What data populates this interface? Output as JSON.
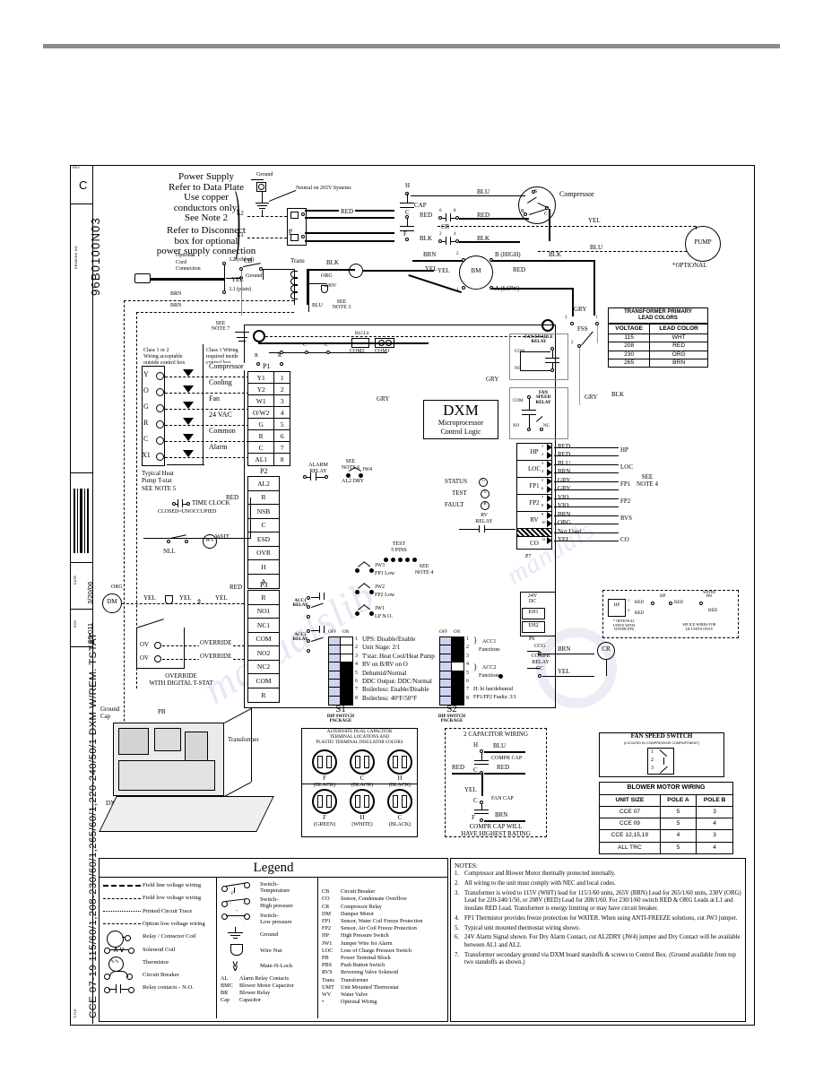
{
  "titleblock": {
    "rev_label": "REV.",
    "rev": "C",
    "drawing_no_label": "DRAWING NO.",
    "drawing_no": "96B0100N03",
    "date_label": "DATE:",
    "date": "3/20/06",
    "ecr_label": "ECR",
    "ecr": "06-011",
    "title_label": "TITLE:",
    "title": "CCE 07-19 115/60/1,208-230/60/1,265/60/1,220-240/50/1 DXM W/REM. TSTAT"
  },
  "power_supply": {
    "heading": [
      "Power Supply",
      "Refer to Data Plate",
      "Use copper",
      "conductors only.",
      "See Note 2"
    ],
    "disconnect": [
      "Refer to Disconnect",
      "box for optional",
      "power supply connection"
    ],
    "ground": "Ground",
    "neutral": "Neutral on 265V Systems",
    "l1": "L1",
    "l2": "L2",
    "pb": "PB",
    "optional_cord": [
      "Optional",
      "Cord",
      "Connection"
    ],
    "l2_ribbed": "L2 (ribbed)",
    "l1_plain": "L1 (plain)",
    "ground_lead": "Ground"
  },
  "wire_colors": {
    "brn": "BRN",
    "blu": "BLU",
    "red": "RED",
    "blk": "BLK",
    "yel": "YEL",
    "gry": "GRY",
    "org": "ORG",
    "vio": "VIO",
    "wht": "WHT",
    "ccg": "CCG",
    "cc": "CC"
  },
  "transformer": {
    "cb": "CB",
    "trans": "Trans",
    "org": "ORG",
    "volts": "230V",
    "see_note3": [
      "SEE",
      "NOTE 3"
    ],
    "yel": "YEL",
    "blu": "BLU",
    "blk": "BLK"
  },
  "compressor_section": {
    "h": "H",
    "c": "C",
    "f": "F",
    "cap": "CAP",
    "cr": "CR",
    "cr_terminals": [
      "6",
      "8",
      "2",
      "4"
    ],
    "compressor": "Compressor",
    "comp_terms": [
      "S",
      "R",
      "C"
    ],
    "bm": "BM",
    "b_high": "B (HIGH)",
    "a_low": "A (LOW)",
    "bm_terms": [
      "2",
      "1"
    ],
    "pump": "PUMP",
    "pump_note": "*OPTIONAL"
  },
  "thermostat": {
    "class_outside": [
      "Class 1 or 2",
      "Wiring acceptable",
      "outside control box"
    ],
    "class_inside": [
      "Class 1 Wiring",
      "required inside",
      "control box"
    ],
    "see_note7": [
      "SEE",
      "NOTE 7"
    ],
    "terminals": [
      "Y",
      "O",
      "G",
      "R",
      "C",
      "X1"
    ],
    "functions": [
      "Compressor",
      "Cooling",
      "Fan",
      "24 VAC",
      "Common",
      "Alarm"
    ],
    "caption": [
      "Typical Heat",
      "Pump T-stat",
      "SEE NOTE 5"
    ]
  },
  "p1": {
    "label": "P1",
    "rows": [
      {
        "name": "Y1",
        "pin": "1"
      },
      {
        "name": "Y2",
        "pin": "2"
      },
      {
        "name": "W1",
        "pin": "3"
      },
      {
        "name": "O/W2",
        "pin": "4"
      },
      {
        "name": "G",
        "pin": "5"
      },
      {
        "name": "R",
        "pin": "6"
      },
      {
        "name": "C",
        "pin": "7"
      },
      {
        "name": "AL1",
        "pin": "8"
      }
    ]
  },
  "p2": {
    "label": "P2",
    "rows": [
      "AL2",
      "R",
      "NSB",
      "C",
      "ESD",
      "OVR",
      "H",
      "A"
    ]
  },
  "p3": {
    "label": "P3",
    "rows": [
      "R",
      "NO1",
      "NC1",
      "COM",
      "NO2",
      "NC2",
      "COM",
      "R"
    ]
  },
  "p6": {
    "label": "P6",
    "rows": [
      "24V DC",
      "EH1",
      "EH2"
    ]
  },
  "p7": {
    "label": "P7",
    "rows": [
      {
        "name": "HP",
        "pins": [
          "1",
          "2"
        ],
        "wires": [
          "RED",
          "RED"
        ],
        "device": "HP"
      },
      {
        "name": "LOC",
        "pins": [
          "3",
          "4"
        ],
        "wires": [
          "BLU",
          "BRN"
        ],
        "device": "LOC"
      },
      {
        "name": "FP1",
        "pins": [
          "5",
          "6"
        ],
        "wires": [
          "GRY",
          "GRY"
        ],
        "device": "FP1"
      },
      {
        "name": "FP2",
        "pins": [
          "7",
          "8"
        ],
        "wires": [
          "VIO",
          "VIO"
        ],
        "device": "FP2"
      },
      {
        "name": "RV",
        "pins": [
          "9",
          "10"
        ],
        "wires": [
          "BRN",
          "ORG"
        ],
        "device": "RVS"
      },
      {
        "name": "",
        "pins": [
          "",
          ""
        ],
        "wires": [
          "Not Used"
        ],
        "device": ""
      },
      {
        "name": "CO",
        "pins": [
          "12"
        ],
        "wires": [
          "YEL"
        ],
        "device": "CO"
      }
    ],
    "see_note4": [
      "SEE",
      "NOTE 4"
    ]
  },
  "relays": {
    "alarm_relay": [
      "ALARM",
      "RELAY"
    ],
    "al2_dry": "AL2 DRY",
    "see_note6": [
      "SEE",
      "NOTE 6"
    ],
    "jw4": "JW4",
    "fan_enable_relay": [
      "FAN ENABLE",
      "RELAY"
    ],
    "fan_speed_relay": [
      "FAN",
      "SPEED",
      "RELAY"
    ],
    "rv_relay": [
      "RV",
      "RELAY"
    ],
    "compr_relay": [
      "COMPR",
      "RELAY"
    ],
    "acc1_relay": [
      "ACC1",
      "RELAY"
    ],
    "acc2_relay": [
      "ACC2",
      "RELAY"
    ],
    "com": "COM",
    "no": "NO",
    "nc": "NC",
    "fss": "FSS",
    "cr": "CR"
  },
  "dxm": {
    "title": "DXM",
    "sub1": "Microprocessor",
    "sub2": "Control Logic",
    "status": "STATUS",
    "status_led": "G",
    "test": "TEST",
    "test_led": "Y",
    "fault": "FAULT",
    "fault_led": "R",
    "test_pins": [
      "TEST",
      "5 PINS"
    ],
    "com1": "COM1",
    "com2": "COM2"
  },
  "jumpers": {
    "jw3": "JW3",
    "jw3_label": "FP1 Low",
    "jw2": "JW2",
    "jw2_label": "FP2 Low",
    "jw1": "JW1",
    "jw1_label": "LP  N.O.",
    "see_note4": [
      "SEE",
      "NOTE 4"
    ]
  },
  "s1": {
    "name": "S1",
    "caption": [
      "DIP SWITCH",
      "PACKAGE"
    ],
    "off": "OFF",
    "on": "ON",
    "switches": [
      {
        "n": "1",
        "label": "UPS: Disable/Enable",
        "state": "off"
      },
      {
        "n": "2",
        "label": "Unit Stage: 2/1",
        "state": "off"
      },
      {
        "n": "3",
        "label": "T'stat: Heat Cool/Heat Pump",
        "state": "off"
      },
      {
        "n": "4",
        "label": "RV on B/RV on O",
        "state": "on"
      },
      {
        "n": "5",
        "label": "Dehumid/Normal",
        "state": "on"
      },
      {
        "n": "6",
        "label": "DDC Output: DDC/Normal",
        "state": "on"
      },
      {
        "n": "7",
        "label": "Boilerless: Enable/Disable",
        "state": "on"
      },
      {
        "n": "8",
        "label": "Boilerless: 40°F/50°F",
        "state": "on"
      }
    ]
  },
  "s2": {
    "name": "S2",
    "caption": [
      "DIP SWITCH",
      "PACKAGE"
    ],
    "off": "OFF",
    "on": "ON",
    "switches": [
      {
        "n": "1",
        "state": "on"
      },
      {
        "n": "2",
        "state": "on"
      },
      {
        "n": "3",
        "state": "on"
      },
      {
        "n": "4",
        "state": "off"
      },
      {
        "n": "5",
        "state": "on"
      },
      {
        "n": "6",
        "state": "on"
      },
      {
        "n": "7",
        "state": "on"
      },
      {
        "n": "8",
        "state": "on"
      }
    ],
    "group1": [
      "ACC1",
      "Functions"
    ],
    "group2": [
      "ACC2",
      "Functions"
    ],
    "note1": "H: hi fan/dehumid",
    "note2": "FP1/FP2 Faults: 3/1"
  },
  "transformer_table": {
    "title": [
      "TRANSFORMER PRIMARY",
      "LEAD COLORS"
    ],
    "headers": [
      "VOLTAGE",
      "LEAD COLOR"
    ],
    "rows": [
      [
        "115",
        "WHT"
      ],
      [
        "208",
        "RED"
      ],
      [
        "230",
        "ORG"
      ],
      [
        "265",
        "BRN"
      ]
    ]
  },
  "blower_table": {
    "title": "BLOWER MOTOR WIRING",
    "headers": [
      "UNIT SIZE",
      "POLE  A",
      "POLE  B"
    ],
    "rows": [
      [
        "CCE 07",
        "5",
        "3"
      ],
      [
        "CCE 09",
        "5",
        "4"
      ],
      [
        "CCE 12,15,19",
        "4",
        "3"
      ],
      [
        "ALL TRC",
        "5",
        "4"
      ]
    ]
  },
  "fan_speed_switch": {
    "title": "FAN SPEED SWITCH",
    "sub": "(LOCATED IN COMPRESSOR COMPARTMENT)",
    "positions": [
      "1",
      "2",
      "3"
    ]
  },
  "alt_capacitor": {
    "title": [
      "ALTERNATE DUAL CAPACITOR",
      "TERMINAL LOCATIONS AND",
      "PLASTIC TERMINAL INSULATOR COLORS"
    ],
    "row1": [
      {
        "t": "F",
        "c": "(BLACK)"
      },
      {
        "t": "C",
        "c": "(BLACK)"
      },
      {
        "t": "H",
        "c": "(BLACK)"
      }
    ],
    "row2": [
      {
        "t": "F",
        "c": "(GREEN)"
      },
      {
        "t": "H",
        "c": "(WHITE)"
      },
      {
        "t": "C",
        "c": "(BLACK)"
      }
    ]
  },
  "two_cap": {
    "title": "2 CAPACITOR WIRING",
    "h": "H",
    "c": "C",
    "f": "F",
    "blu": "BLU",
    "red_l": "RED",
    "red_r": "RED",
    "yel": "YEL",
    "brn": "BRN",
    "compr_cap": "COMPR CAP",
    "fan_cap": "FAN CAP",
    "footer": [
      "COMPR CAP WILL",
      "HAVE HIGHEST RATING"
    ]
  },
  "water_fps": {
    "hp": "HP",
    "pins": [
      "1",
      "2"
    ],
    "red": "RED",
    "hp_label": "HP",
    "water_fps": [
      "WATER",
      "FPS"
    ],
    "note_left": [
      "* OPTIONAL",
      "UNITS WITH",
      "WATER FPS"
    ],
    "note_right": [
      "SPLICE WIRES FOR",
      "LR UNITS ONLY"
    ]
  },
  "time_clock": {
    "line1": "TIME CLOCK",
    "line2": "CLOSED=UNOCCUPIED",
    "wht": "WHT",
    "nll": "NLL",
    "wv": "WV",
    "dm": "DM",
    "org": "ORG"
  },
  "override": {
    "terminals": [
      "OV",
      "OV"
    ],
    "labels": [
      "OVERRIDE",
      "OVERRIDE"
    ],
    "caption": [
      "OVERRIDE",
      "WITH DIGITAL T-STAT"
    ]
  },
  "photo": {
    "ground_cap": [
      "Ground",
      "Cap"
    ],
    "pb": "PB",
    "transformer": "Transformer",
    "cr": "CR",
    "dxm": "DXM"
  },
  "legend": {
    "title": "Legend",
    "col1": [
      {
        "sym": "field-line-voltage",
        "label": "Field line voltage wiring"
      },
      {
        "sym": "field-low-voltage",
        "label": "Field low voltage wiring"
      },
      {
        "sym": "printed-circuit-trace",
        "label": "Printed Circuit Trace"
      },
      {
        "sym": "option-low-voltage",
        "label": "Option low voltage wiring"
      },
      {
        "sym": "relay-coil",
        "label": "Relay / Contactor Coil"
      },
      {
        "sym": "solenoid-coil",
        "label": "Solenoid Coil"
      },
      {
        "sym": "thermistor",
        "label": "Thermistor"
      },
      {
        "sym": "circuit-breaker",
        "label": "Circuit Breaker"
      },
      {
        "sym": "relay-contacts-no",
        "label": "Relay contacts - N.O."
      }
    ],
    "col2": [
      {
        "sym": "switch-temperature",
        "label": [
          "Switch-",
          "Temperature"
        ]
      },
      {
        "sym": "switch-high-pressure",
        "label": [
          "Switch-",
          "High pressure"
        ]
      },
      {
        "sym": "switch-low-pressure",
        "label": [
          "Switch-",
          "Low pressure"
        ]
      },
      {
        "sym": "ground",
        "label": [
          "Ground"
        ]
      },
      {
        "sym": "wire-nut",
        "label": [
          "Wire Nut"
        ]
      },
      {
        "sym": "mate-n-lock",
        "label": [
          "Mate-N-Lock"
        ]
      }
    ],
    "col2_abbr": [
      {
        "k": "AL",
        "v": "Alarm Relay Contacts"
      },
      {
        "k": "BMC",
        "v": "Blower Motor Capacitor"
      },
      {
        "k": "BR",
        "v": "Blower Relay"
      },
      {
        "k": "Cap",
        "v": "Capacitor"
      }
    ],
    "col3": [
      {
        "k": "CB",
        "v": "Circuit Breaker"
      },
      {
        "k": "CO",
        "v": "Sensor, Condensate Overflow"
      },
      {
        "k": "CR",
        "v": "Compressor Relay"
      },
      {
        "k": "DM",
        "v": "Damper Motor"
      },
      {
        "k": "FP1",
        "v": "Sensor, Water Coil Freeze Protection"
      },
      {
        "k": "FP2",
        "v": "Sensor, Air Coil Freeze Protection"
      },
      {
        "k": "HP",
        "v": "High Pressure Switch"
      },
      {
        "k": "JW1",
        "v": "Jumper Wire for Alarm"
      },
      {
        "k": "LOC",
        "v": "Loss of Charge Pressure Switch"
      },
      {
        "k": "PB",
        "v": "Power Terminal Block"
      },
      {
        "k": "PBS",
        "v": "Push Button Switch"
      },
      {
        "k": "RVS",
        "v": "Reversing Valve Solenoid"
      },
      {
        "k": "Trans",
        "v": "Transformer"
      },
      {
        "k": "UMT",
        "v": "Unit Mounted Thermostat"
      },
      {
        "k": "WV",
        "v": "Water Valve"
      },
      {
        "k": "•",
        "v": "Optional Wiring"
      }
    ]
  },
  "notes": {
    "title": "NOTES:",
    "items": [
      {
        "n": "1.",
        "text": "Compressor and Blower Motor thermally protected internally."
      },
      {
        "n": "2.",
        "text": "All wiring to the unit must comply with NEC and local codes."
      },
      {
        "n": "3.",
        "text": "Transformer is wired to 115V (WHT) lead for 115/1/60 units, 265V (BRN) Lead for 265/1/60 units, 230V (ORG) Lead for 220-240/1/50, or 208V (RED) Lead for 208/1/60. For 230/1/60 switch RED & ORG Leads at L1 and insulate RED Lead. Transformer is energy limiting or may have circuit breaker."
      },
      {
        "n": "4.",
        "text": "FP1 Thermistor provides freeze protection for WATER.  When using ANTI-FREEZE solutions, cut JW3 jumper."
      },
      {
        "n": "5.",
        "text": "Typical unit mounted thermostat wiring shown."
      },
      {
        "n": "6.",
        "text": "24V Alarm Signal shown. For Dry Alarm Contact, cut AL2DRY (JW4) jumper and Dry Contact will be available between AL1 and AL2."
      },
      {
        "n": "7.",
        "text": "Transformer secondary ground via DXM board standoffs & screws to Control Box. (Ground available from top two standoffs as shown.)"
      }
    ]
  },
  "misc": {
    "not_used": "Not Used",
    "rlcls": "RLCLS",
    "ov": "OV",
    "co_1_pins": "CO  1"
  }
}
